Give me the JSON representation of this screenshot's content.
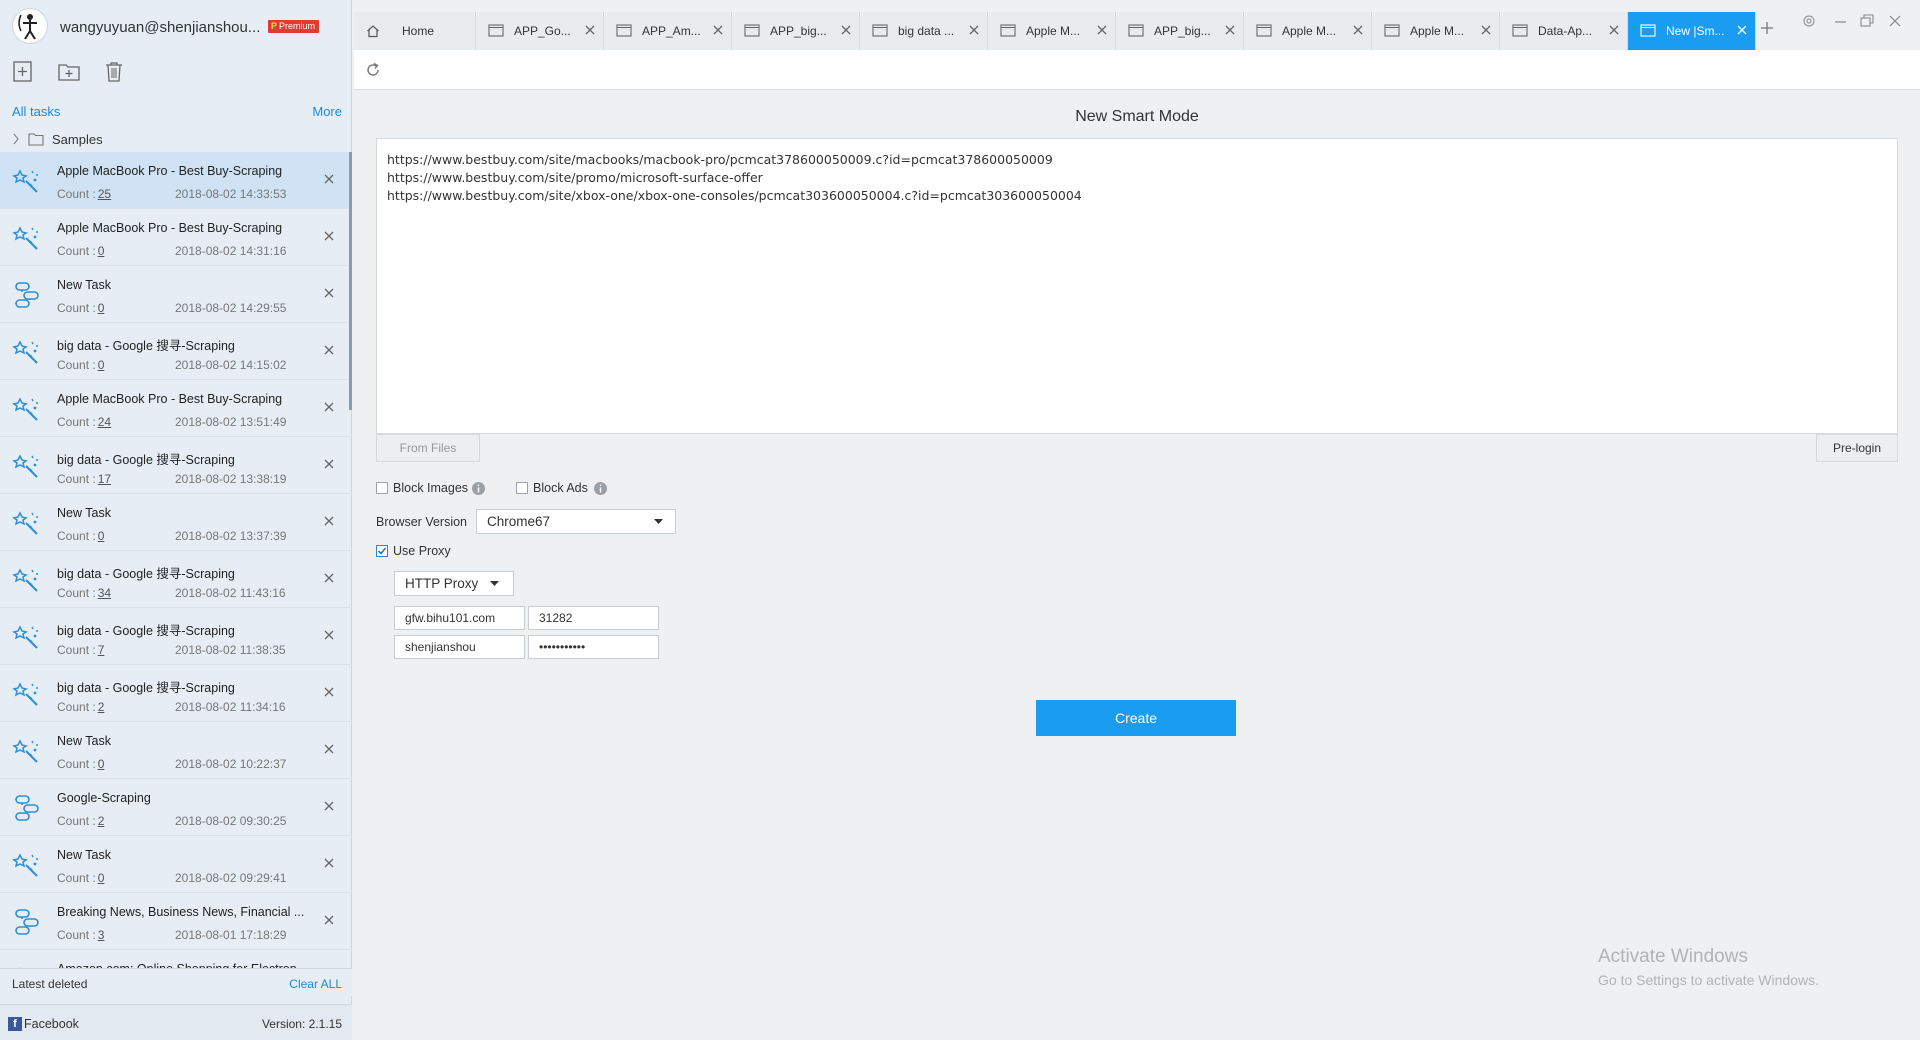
{
  "user": {
    "email": "wangyuyuan@shenjianshou...",
    "badge_prefix": "P",
    "badge": "Premium"
  },
  "sidebar": {
    "all_tasks": "All tasks",
    "more": "More",
    "samples": "Samples",
    "tasks": [
      {
        "name": "Apple MacBook Pro - Best Buy-Scraping",
        "count_label": "Count :",
        "count": "25",
        "date": "2018-08-02 14:33:53",
        "icon": "smart-wand-icon",
        "selected": true
      },
      {
        "name": "Apple MacBook Pro - Best Buy-Scraping",
        "count_label": "Count :",
        "count": "0",
        "date": "2018-08-02 14:31:16",
        "icon": "smart-wand-icon"
      },
      {
        "name": "New Task",
        "count_label": "Count :",
        "count": "0",
        "date": "2018-08-02 14:29:55",
        "icon": "flow-icon"
      },
      {
        "name": "big data - Google 搜寻-Scraping",
        "count_label": "Count :",
        "count": "0",
        "date": "2018-08-02 14:15:02",
        "icon": "smart-wand-icon"
      },
      {
        "name": "Apple MacBook Pro - Best Buy-Scraping",
        "count_label": "Count :",
        "count": "24",
        "date": "2018-08-02 13:51:49",
        "icon": "smart-wand-icon"
      },
      {
        "name": "big data - Google 搜寻-Scraping",
        "count_label": "Count :",
        "count": "17",
        "date": "2018-08-02 13:38:19",
        "icon": "smart-wand-icon"
      },
      {
        "name": "New Task",
        "count_label": "Count :",
        "count": "0",
        "date": "2018-08-02 13:37:39",
        "icon": "smart-wand-icon"
      },
      {
        "name": "big data - Google 搜寻-Scraping",
        "count_label": "Count :",
        "count": "34",
        "date": "2018-08-02 11:43:16",
        "icon": "smart-wand-icon"
      },
      {
        "name": "big data - Google 搜寻-Scraping",
        "count_label": "Count :",
        "count": "7",
        "date": "2018-08-02 11:38:35",
        "icon": "smart-wand-icon"
      },
      {
        "name": "big data - Google 搜寻-Scraping",
        "count_label": "Count :",
        "count": "2",
        "date": "2018-08-02 11:34:16",
        "icon": "smart-wand-icon"
      },
      {
        "name": "New Task",
        "count_label": "Count :",
        "count": "0",
        "date": "2018-08-02 10:22:37",
        "icon": "smart-wand-icon"
      },
      {
        "name": "Google-Scraping",
        "count_label": "Count :",
        "count": "2",
        "date": "2018-08-02 09:30:25",
        "icon": "flow-icon"
      },
      {
        "name": "New Task",
        "count_label": "Count :",
        "count": "0",
        "date": "2018-08-02 09:29:41",
        "icon": "smart-wand-icon"
      },
      {
        "name": "Breaking News, Business News, Financial ...",
        "count_label": "Count :",
        "count": "3",
        "date": "2018-08-01 17:18:29",
        "icon": "flow-icon"
      },
      {
        "name": "Amazon.com: Online Shopping for Electron",
        "count_label": "",
        "count": "",
        "date": "",
        "icon": "smart-wand-icon"
      }
    ],
    "latest_deleted": "Latest deleted",
    "clear_all": "Clear ALL",
    "facebook": "Facebook",
    "version": "Version: 2.1.15"
  },
  "tabs": [
    {
      "label": "Home",
      "type": "home"
    },
    {
      "label": "APP_Go...",
      "type": "page"
    },
    {
      "label": "APP_Am...",
      "type": "page"
    },
    {
      "label": "APP_big...",
      "type": "page"
    },
    {
      "label": "big data ...",
      "type": "page"
    },
    {
      "label": "Apple M...",
      "type": "page"
    },
    {
      "label": "APP_big...",
      "type": "page"
    },
    {
      "label": "Apple M...",
      "type": "page"
    },
    {
      "label": "Apple M...",
      "type": "page"
    },
    {
      "label": "Data-Ap...",
      "type": "page"
    },
    {
      "label": "New |Sm...",
      "type": "page",
      "active": true
    }
  ],
  "main": {
    "title": "New Smart Mode",
    "urls": [
      "https://www.bestbuy.com/site/macbooks/macbook-pro/pcmcat378600050009.c?id=pcmcat378600050009",
      "https://www.bestbuy.com/site/promo/microsoft-surface-offer",
      "https://www.bestbuy.com/site/xbox-one/xbox-one-consoles/pcmcat303600050004.c?id=pcmcat303600050004"
    ],
    "from_files": "From Files",
    "pre_login": "Pre-login",
    "block_images": "Block Images",
    "block_ads": "Block Ads",
    "browser_version_label": "Browser Version",
    "browser_version": "Chrome67",
    "use_proxy": "Use Proxy",
    "proxy_type": "HTTP Proxy",
    "proxy_host": "gfw.bihu101.com",
    "proxy_port": "31282",
    "proxy_user": "shenjianshou",
    "proxy_password": "•••••••••••",
    "create": "Create"
  },
  "watermark": {
    "title": "Activate Windows",
    "subtitle": "Go to Settings to activate Windows."
  },
  "colors": {
    "accent": "#1a9cf0",
    "sidebar_bg": "#e6edf4",
    "selected_row": "#cfe3f5",
    "badge": "#e53935"
  }
}
